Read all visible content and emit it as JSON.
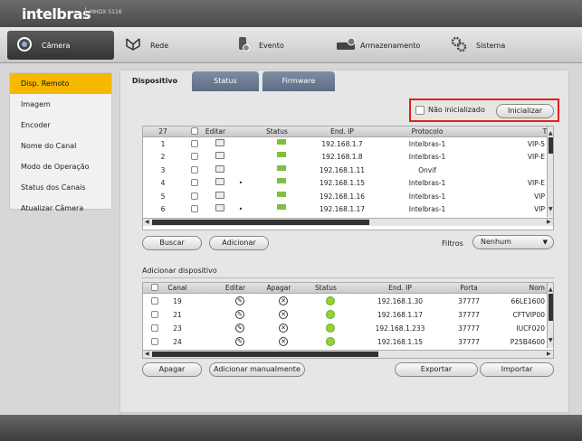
{
  "brand": {
    "logo": "intelbras",
    "model": "MHDX 5116"
  },
  "nav": [
    {
      "label": "Câmera",
      "icon": "camera-icon"
    },
    {
      "label": "Rede",
      "icon": "network-icon"
    },
    {
      "label": "Evento",
      "icon": "event-icon"
    },
    {
      "label": "Armazenamento",
      "icon": "storage-icon"
    },
    {
      "label": "Sistema",
      "icon": "settings-gears-icon"
    }
  ],
  "sidebar": [
    {
      "label": "Disp. Remoto"
    },
    {
      "label": "Imagem"
    },
    {
      "label": "Encoder"
    },
    {
      "label": "Nome do Canal"
    },
    {
      "label": "Modo de Operação"
    },
    {
      "label": "Status dos Canais"
    },
    {
      "label": "Atualizar Câmera"
    }
  ],
  "tabs": [
    {
      "label": "Dispositivo"
    },
    {
      "label": "Status"
    },
    {
      "label": "Firmware"
    }
  ],
  "init": {
    "checkbox_label": "Não inicializado",
    "button": "Inicializar"
  },
  "devices": {
    "count": "27",
    "headers": {
      "edit": "Editar",
      "status": "Status",
      "ip": "End. IP",
      "protocol": "Protocolo",
      "type": "Ti"
    },
    "rows": [
      {
        "n": "1",
        "dot": "",
        "ip": "192.168.1.7",
        "protocol": "Intelbras-1",
        "type": "VIP-5"
      },
      {
        "n": "2",
        "dot": "",
        "ip": "192.168.1.8",
        "protocol": "Intelbras-1",
        "type": "VIP-E"
      },
      {
        "n": "3",
        "dot": "",
        "ip": "192.168.1.11",
        "protocol": "Onvif",
        "type": ""
      },
      {
        "n": "4",
        "dot": "•",
        "ip": "192.168.1.15",
        "protocol": "Intelbras-1",
        "type": "VIP-E"
      },
      {
        "n": "5",
        "dot": "",
        "ip": "192.168.1.16",
        "protocol": "Intelbras-1",
        "type": "VIP"
      },
      {
        "n": "6",
        "dot": "•",
        "ip": "192.168.1.17",
        "protocol": "Intelbras-1",
        "type": "VIP"
      }
    ]
  },
  "buttons": {
    "search": "Buscar",
    "add": "Adicionar",
    "delete": "Apagar",
    "manual_add": "Adicionar manualmente",
    "export": "Exportar",
    "import": "Importar"
  },
  "filter": {
    "label": "Filtros",
    "value": "Nenhum"
  },
  "added": {
    "title": "Adicionar dispositivo",
    "headers": {
      "channel": "Canal",
      "edit": "Editar",
      "delete": "Apagar",
      "status": "Status",
      "ip": "End. IP",
      "port": "Porta",
      "name": "Nom"
    },
    "rows": [
      {
        "channel": "19",
        "ip": "192.168.1.30",
        "port": "37777",
        "name": "66LE1600"
      },
      {
        "channel": "21",
        "ip": "192.168.1.17",
        "port": "37777",
        "name": "CFTVIP00"
      },
      {
        "channel": "23",
        "ip": "192.168.1.233",
        "port": "37777",
        "name": "IUCF020"
      },
      {
        "channel": "24",
        "ip": "192.168.1.15",
        "port": "37777",
        "name": "P25B4600"
      }
    ]
  },
  "colors": {
    "accent": "#f6b800",
    "highlight_border": "#e0201b",
    "tab_blue": "#6c7d94",
    "status_green": "#95d22c"
  }
}
